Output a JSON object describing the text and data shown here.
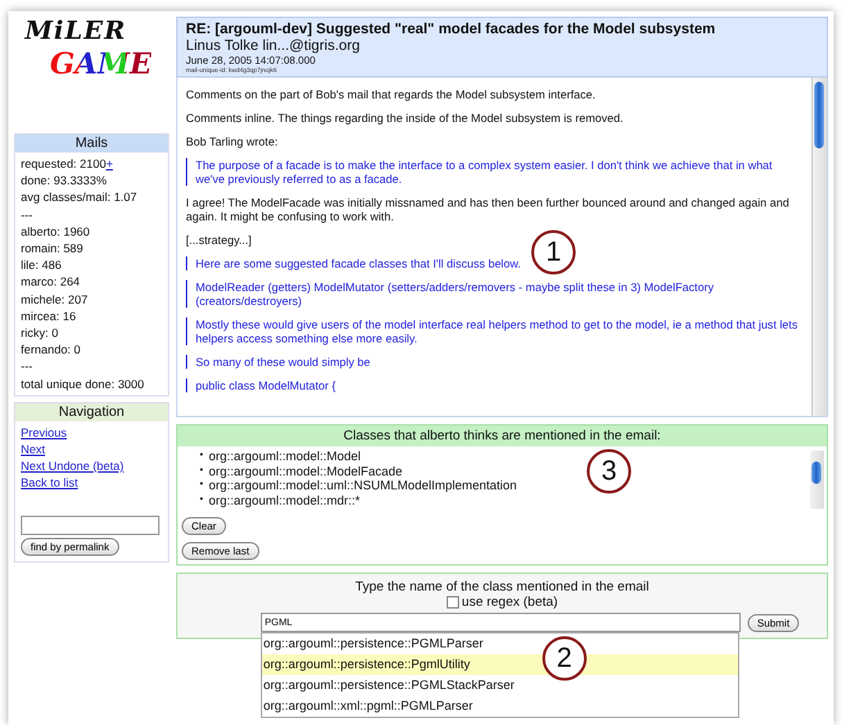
{
  "logo": {
    "line1": "MiLER",
    "line2": "GAME"
  },
  "mails_panel": {
    "title": "Mails",
    "stats": [
      {
        "text": "requested: 2100",
        "link": "+"
      },
      {
        "text": "done: 93.3333%"
      },
      {
        "text": "avg classes/mail: 1.07"
      },
      {
        "text": "---"
      },
      {
        "text": "alberto: 1960"
      },
      {
        "text": "romain: 589"
      },
      {
        "text": "lile: 486"
      },
      {
        "text": "marco: 264"
      },
      {
        "text": "michele: 207"
      },
      {
        "text": "mircea: 16"
      },
      {
        "text": "ricky: 0"
      },
      {
        "text": "fernando: 0"
      },
      {
        "text": "---"
      },
      {
        "text": "total unique done: 3000"
      }
    ]
  },
  "navigation": {
    "title": "Navigation",
    "links": [
      "Previous",
      "Next",
      "Next Undone (beta)",
      "Back to list"
    ],
    "button": "find by permalink"
  },
  "mail": {
    "subject": "RE: [argouml-dev] Suggested \"real\" model facades for the Model subsystem",
    "sender": "Linus Tolke lin...@tigris.org",
    "date": "June 28, 2005 14:07:08.000",
    "unique_id": "mail-unique-id: kwd4g3qp7jnojk6",
    "paragraphs": [
      {
        "kind": "plain",
        "text": "Comments on the part of Bob's mail that regards the Model subsystem interface."
      },
      {
        "kind": "plain",
        "text": "Comments inline. The things regarding the inside of the Model subsystem is removed."
      },
      {
        "kind": "plain",
        "text": "Bob Tarling wrote:"
      },
      {
        "kind": "quote",
        "text": "The purpose of a facade is to make the interface to a complex system easier. I don't think we achieve that in what we've previously referred to as a facade."
      },
      {
        "kind": "plain",
        "text": "I agree! The ModelFacade was initially missnamed and has then been further bounced around and changed again and again. It might be confusing to work with."
      },
      {
        "kind": "plain",
        "text": "[...strategy...]"
      },
      {
        "kind": "quote",
        "text": "Here are some suggested facade classes that I'll discuss below."
      },
      {
        "kind": "quote",
        "text": "ModelReader (getters) ModelMutator (setters/adders/removers - maybe split these in 3) ModelFactory (creators/destroyers)"
      },
      {
        "kind": "quote",
        "text": "Mostly these would give users of the model interface real helpers method to get to the model, ie a method that just lets helpers access something else more easily."
      },
      {
        "kind": "quote",
        "text": "So many of these would simply be"
      },
      {
        "kind": "quote",
        "text": "public class ModelMutator {"
      }
    ],
    "callout": "1"
  },
  "classes": {
    "title": "Classes that alberto thinks are mentioned in the email:",
    "bullet": "•",
    "items": [
      "org::argouml::model::Model",
      "org::argouml::model::ModelFacade",
      "org::argouml::model::uml::NSUMLModelImplementation",
      "org::argouml::model::mdr::*"
    ],
    "buttons": [
      "Clear",
      "Remove last"
    ],
    "callout": "3"
  },
  "entry": {
    "prompt": "Type the name of the class mentioned in the email",
    "regex": {
      "label": "use regex (beta)",
      "checked": false
    },
    "value": "PGML",
    "submit": "Submit",
    "suggestions": [
      {
        "text": "org::argouml::persistence::PGMLParser",
        "selected": false
      },
      {
        "text": "org::argouml::persistence::PgmlUtility",
        "selected": true
      },
      {
        "text": "org::argouml::persistence::PGMLStackParser",
        "selected": false
      },
      {
        "text": "org::argouml::xml::pgml::PGMLParser",
        "selected": false
      }
    ],
    "callout": "2"
  }
}
